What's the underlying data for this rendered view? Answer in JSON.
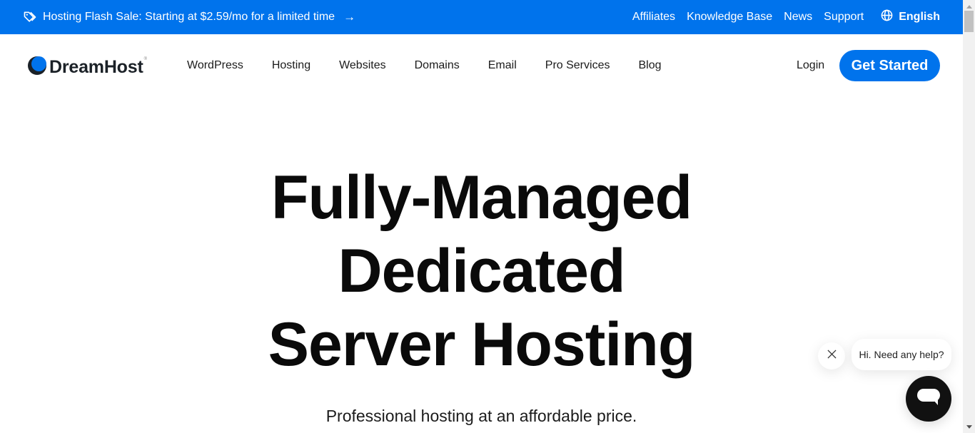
{
  "topbar": {
    "promo_icon": "tag-icon",
    "promo_text": "Hosting Flash Sale: Starting at $2.59/mo for a limited time",
    "promo_arrow": "→",
    "links": [
      {
        "label": "Affiliates"
      },
      {
        "label": "Knowledge Base"
      },
      {
        "label": "News"
      },
      {
        "label": "Support"
      }
    ],
    "language": {
      "icon": "globe-icon",
      "label": "English"
    },
    "background_color": "#0073ec"
  },
  "header": {
    "logo_text": "DreamHost",
    "logo_mark": "®",
    "nav": [
      {
        "label": "WordPress"
      },
      {
        "label": "Hosting"
      },
      {
        "label": "Websites"
      },
      {
        "label": "Domains"
      },
      {
        "label": "Email"
      },
      {
        "label": "Pro Services"
      },
      {
        "label": "Blog"
      }
    ],
    "login_label": "Login",
    "cta_label": "Get Started",
    "accent_color": "#0073ec"
  },
  "hero": {
    "title_lines": [
      "Fully-Managed",
      "Dedicated",
      "Server Hosting"
    ],
    "subtitle": "Professional hosting at an affordable price."
  },
  "chat": {
    "greeting": "Hi. Need any help?",
    "close_icon": "close-icon",
    "launcher_icon": "chat-icon"
  }
}
